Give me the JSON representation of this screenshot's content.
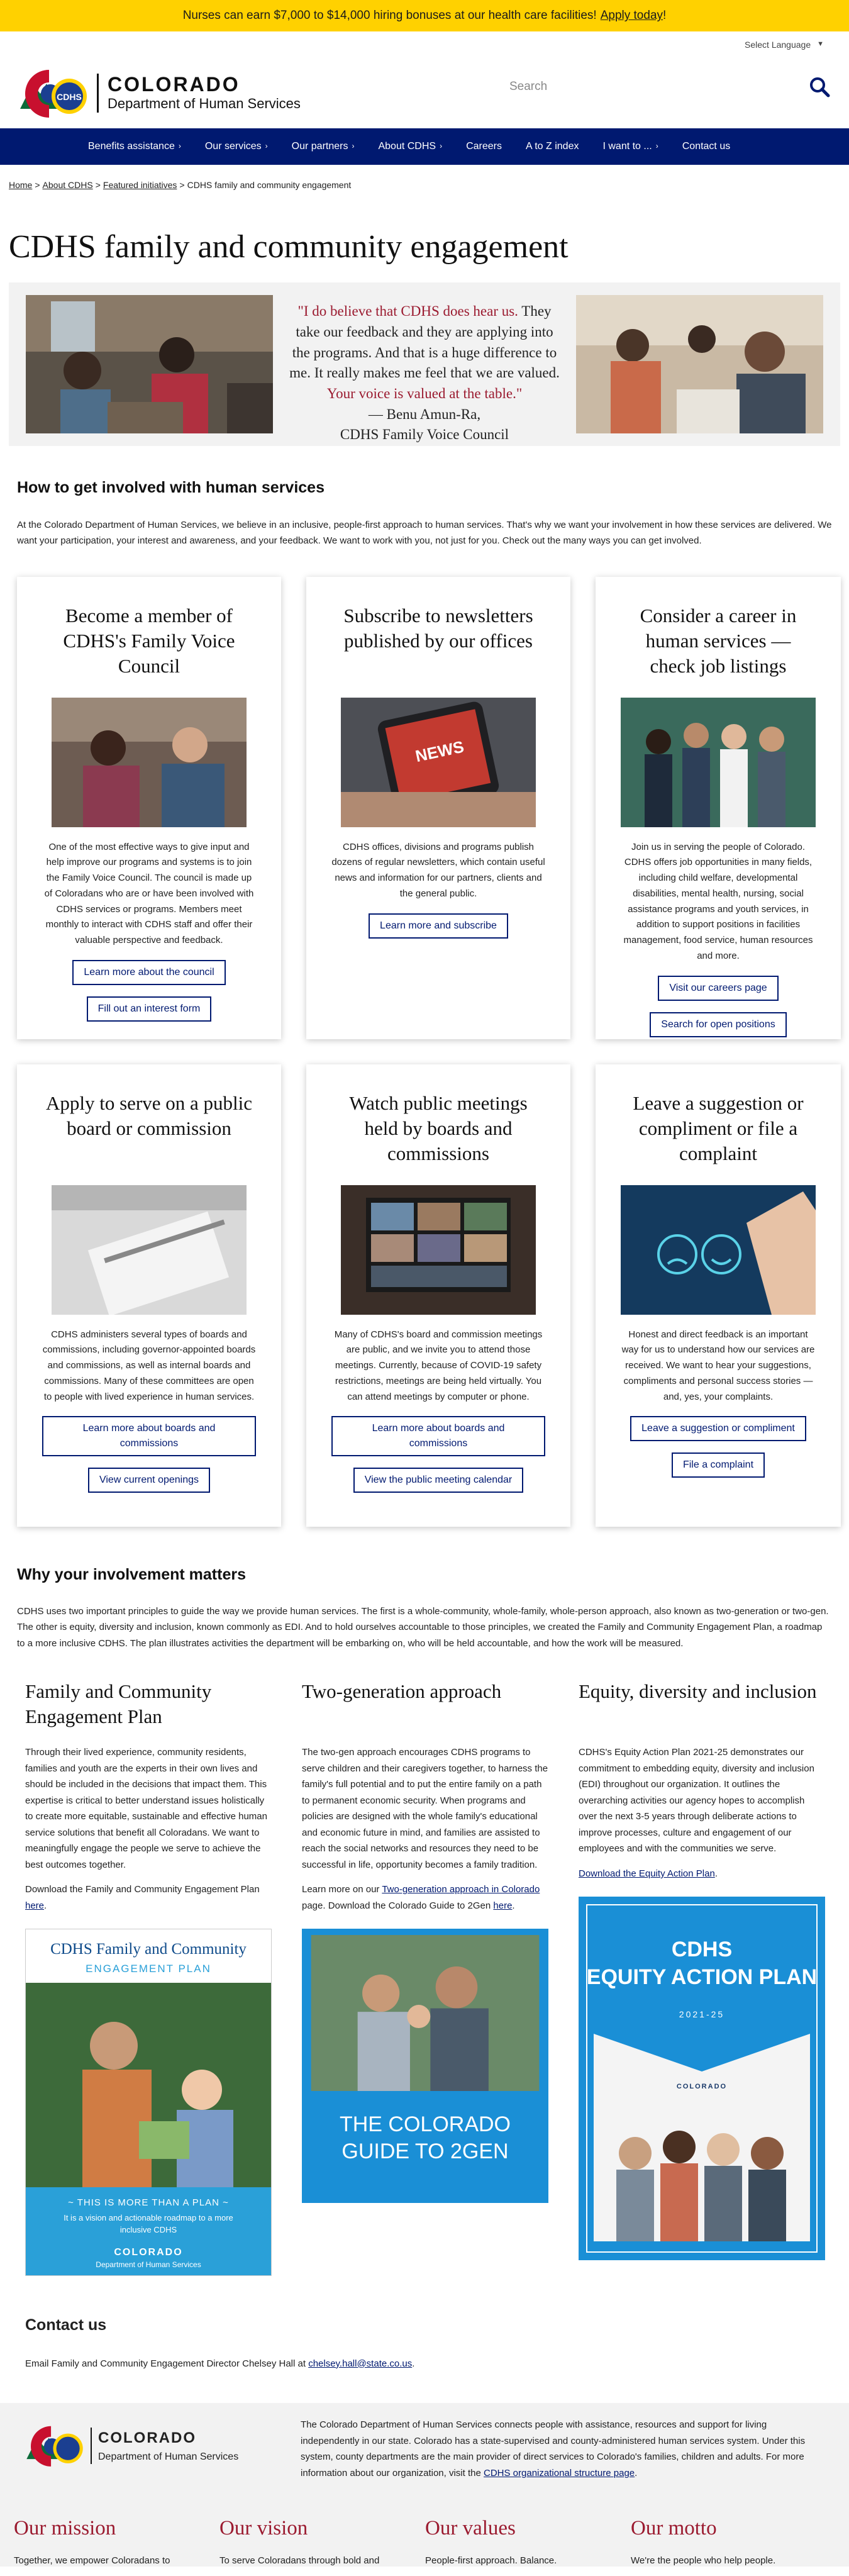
{
  "alert": {
    "text": "Nurses can earn $7,000 to $14,000 hiring bonuses at our health care facilities!",
    "link": "Apply today",
    "tail": "!"
  },
  "header": {
    "language": "Select Language",
    "logo_state": "COLORADO",
    "logo_dept": "Department of Human Services",
    "search_placeholder": "Search"
  },
  "nav": [
    {
      "label": "Benefits assistance",
      "has_sub": true
    },
    {
      "label": "Our services",
      "has_sub": true
    },
    {
      "label": "Our partners",
      "has_sub": true
    },
    {
      "label": "About CDHS",
      "has_sub": true
    },
    {
      "label": "Careers",
      "has_sub": false
    },
    {
      "label": "A to Z index",
      "has_sub": false
    },
    {
      "label": "I want to ...",
      "has_sub": true
    },
    {
      "label": "Contact us",
      "has_sub": false
    }
  ],
  "breadcrumb": [
    "Home",
    "About CDHS",
    "Featured initiatives",
    "CDHS family and community engagement"
  ],
  "page_title": "CDHS family and community engagement",
  "hero_quote": {
    "open": "\"I do believe that CDHS does hear us.",
    "middle": "They take our feedback and they are applying into the programs. And that is a huge difference to me. It really makes me feel that we are valued.",
    "close": "Your voice is valued at the table.\"",
    "attribution": "— Benu Amun-Ra,",
    "org": "CDHS Family Voice Council"
  },
  "get_involved": {
    "heading": "How to get involved with human services",
    "intro": "At the Colorado Department of Human Services, we believe in an inclusive, people-first approach to human services. That's why we want your involvement in how these services are delivered. We want your participation, your interest and awareness, and your feedback. We want to work with you, not just for you. Check out the many ways you can get involved."
  },
  "cards": [
    {
      "title": "Become a member of CDHS's Family Voice Council",
      "text": "One of the most effective ways to give input and help improve our programs and systems is to join the Family Voice Council. The council is made up of Coloradans who are or have been involved with CDHS services or programs. Members meet monthly to interact with CDHS staff and offer their valuable perspective and feedback.",
      "buttons": [
        "Learn more about the council",
        "Fill out an interest form"
      ]
    },
    {
      "title": "Subscribe to newsletters published by our offices",
      "text": "CDHS offices, divisions and programs publish dozens of regular newsletters, which contain useful news and information for our partners, clients and the general public.",
      "buttons": [
        "Learn more and subscribe"
      ]
    },
    {
      "title": "Consider a career in human services — check job listings",
      "text": "Join us in serving the people of Colorado. CDHS offers job opportunities in many fields, including child welfare, developmental disabilities, mental health, nursing, social assistance programs and youth services, in addition to support positions in facilities management, food service, human resources and more.",
      "buttons": [
        "Visit our careers page",
        "Search for open positions"
      ]
    },
    {
      "title": "Apply to serve on a public board or commission",
      "text": "CDHS administers several types of boards and commissions, including governor-appointed boards and commissions, as well as internal boards and commissions. Many of these committees are open to people with lived experience in human services.",
      "buttons": [
        "Learn more about boards and commissions",
        "View current openings"
      ]
    },
    {
      "title": "Watch public meetings held by boards and commissions",
      "text": "Many of CDHS's board and commission meetings are public, and we invite you to attend those meetings. Currently, because of COVID-19 safety restrictions, meetings are being held virtually. You can attend meetings by computer or phone.",
      "buttons": [
        "Learn more about boards and commissions",
        "View the public meeting calendar"
      ]
    },
    {
      "title": "Leave a suggestion or compliment or file a complaint",
      "text": "Honest and direct feedback is an important way for us to understand how our services are received. We want to hear your suggestions, compliments and personal success stories — and, yes, your complaints.",
      "buttons": [
        "Leave a suggestion or compliment",
        "File a complaint"
      ]
    }
  ],
  "why": {
    "heading": "Why your involvement matters",
    "intro": "CDHS uses two important principles to guide the way we provide human services. The first is a whole-community, whole-family, whole-person approach, also known as two-generation or two-gen. The other is equity, diversity and inclusion, known commonly as EDI. And to hold ourselves accountable to those principles, we created the Family and Community Engagement Plan, a roadmap to a more inclusive CDHS. The plan illustrates activities the department will be embarking on, who will be held accountable, and how the work will be measured."
  },
  "columns": [
    {
      "title": "Family and Community Engagement Plan",
      "text": "Through their lived experience, community residents, families and youth are the experts in their own lives and should be included in the decisions that impact them. This expertise is critical to better understand issues holistically to create more equitable, sustainable and effective human service solutions that benefit all Coloradans. We want to meaningfully engage the people we serve to achieve the best outcomes together.",
      "link_pre": "Download the Family and Community Engagement Plan",
      "link": "here",
      "link_post": ".",
      "poster": {
        "title": "CDHS Family and Community",
        "subtitle": "ENGAGEMENT PLAN",
        "tag1": "~ THIS IS MORE THAN A PLAN ~",
        "tag2": "It is a vision and actionable roadmap to a more inclusive CDHS",
        "brand": "COLORADO",
        "brand2": "Department of Human Services"
      }
    },
    {
      "title": "Two-generation approach",
      "text": "The two-gen approach encourages CDHS programs to serve children and their caregivers together, to harness the family's full potential and to put the entire family on a path to permanent economic security. When programs and policies are designed with the whole family's educational and economic future in mind, and families are assisted to reach the social networks and resources they need to be successful in life, opportunity becomes a family tradition.",
      "link_pre": "Learn more on our",
      "link": "Two-generation approach in Colorado",
      "link_mid": "page. Download the Colorado Guide to 2Gen",
      "link2": "here",
      "link_post": ".",
      "poster": {
        "title": "THE COLORADO GUIDE TO 2GEN"
      }
    },
    {
      "title": "Equity, diversity and inclusion",
      "text": "CDHS's Equity Action Plan 2021-25 demonstrates our commitment to embedding equity, diversity and inclusion (EDI) throughout our organization. It outlines the overarching activities our agency hopes to accomplish over the next 3-5 years through deliberate actions to improve processes, culture and engagement of our employees and with the communities we serve.",
      "link": "Download the Equity Action Plan",
      "link_post": ".",
      "poster": {
        "title": "CDHS",
        "subtitle": "EQUITY ACTION PLAN",
        "years": "2021-25",
        "brand": "COLORADO",
        "brand2": "Department of Human Services"
      }
    }
  ],
  "contact": {
    "heading": "Contact us",
    "text": "Email Family and Community Engagement Director Chelsey Hall at",
    "email": "chelsey.hall@state.co.us",
    "tail": "."
  },
  "footer": {
    "logo_state": "COLORADO",
    "logo_dept": "Department of Human Services",
    "text": "The Colorado Department of Human Services connects people with assistance, resources and support for living independently in our state. Colorado has a state-supervised and county-administered human services system. Under this system, county departments are the main provider of direct services to Colorado's families, children and adults. For more information about our organization, visit the",
    "link": "CDHS organizational structure page",
    "tail": ".",
    "mvv": [
      {
        "h": "Our mission",
        "p": "Together, we empower Coloradans to"
      },
      {
        "h": "Our vision",
        "p": "To serve Coloradans through bold and"
      },
      {
        "h": "Our values",
        "p": "People-first approach. Balance."
      },
      {
        "h": "Our motto",
        "p": "We're the people who help people."
      }
    ]
  },
  "colors": {
    "alert": "#ffd100",
    "nav": "#001970",
    "accent_red": "#9b1b30",
    "poster_blue": "#1a8fd6"
  }
}
